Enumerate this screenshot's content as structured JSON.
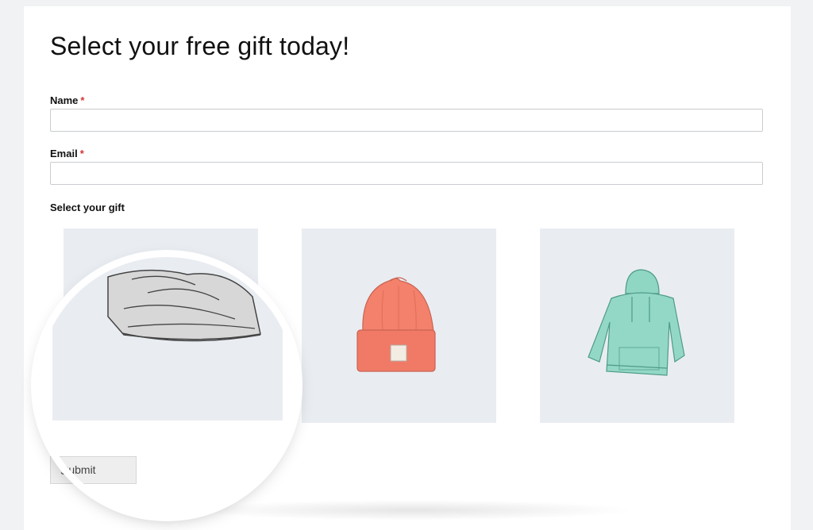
{
  "form": {
    "title": "Select your free gift today!",
    "name_label": "Name",
    "email_label": "Email",
    "required_marker": "*",
    "gift_label": "Select your gift",
    "submit_label": "Submit",
    "name_value": "",
    "email_value": ""
  },
  "gifts": [
    {
      "icon": "beanie-gray-icon",
      "color": "#c9c9c9"
    },
    {
      "icon": "beanie-orange-icon",
      "color": "#f27c66"
    },
    {
      "icon": "hoodie-mint-icon",
      "color": "#8fd6c3"
    }
  ],
  "colors": {
    "required": "#d63638",
    "tile_bg": "#e9edf2",
    "page_bg": "#f1f2f4"
  }
}
